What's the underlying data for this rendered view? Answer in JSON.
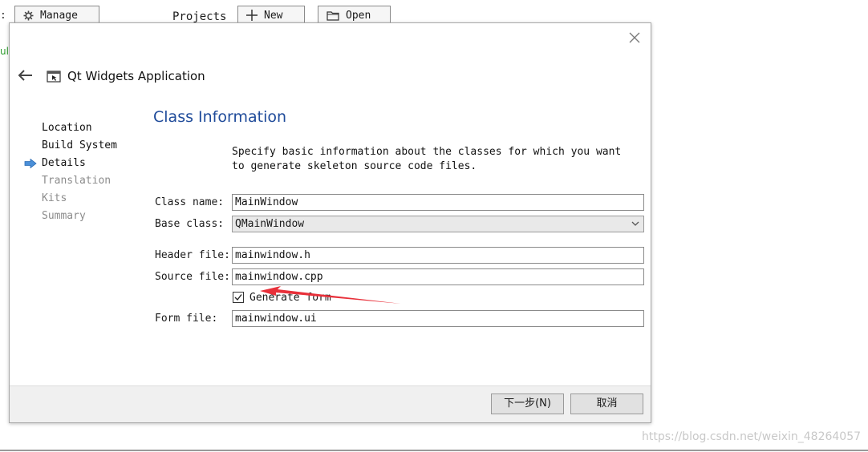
{
  "background": {
    "left_mark": ":",
    "manage_button": "Manage",
    "projects_label": "Projects",
    "new_button": "New",
    "open_button": "Open",
    "green_text": "ul",
    "watermark": "https://blog.csdn.net/weixin_48264057"
  },
  "dialog": {
    "title": "Qt Widgets Application",
    "steps": [
      {
        "label": "Location",
        "state": "done"
      },
      {
        "label": "Build System",
        "state": "done"
      },
      {
        "label": "Details",
        "state": "current"
      },
      {
        "label": "Translation",
        "state": "future"
      },
      {
        "label": "Kits",
        "state": "future"
      },
      {
        "label": "Summary",
        "state": "future"
      }
    ],
    "page_title": "Class Information",
    "description": "Specify basic information about the classes for which you want to generate skeleton source code files.",
    "fields": {
      "class_name_label": "Class name:",
      "class_name_value": "MainWindow",
      "base_class_label": "Base class:",
      "base_class_value": "QMainWindow",
      "header_file_label": "Header file:",
      "header_file_value": "mainwindow.h",
      "source_file_label": "Source file:",
      "source_file_value": "mainwindow.cpp",
      "generate_form_label": "Generate form",
      "generate_form_checked": true,
      "form_file_label": "Form file:",
      "form_file_value": "mainwindow.ui"
    },
    "buttons": {
      "next": "下一步(N)",
      "cancel": "取消"
    }
  },
  "colors": {
    "title_blue": "#1f4b9a",
    "step_arrow": "#4a8fd8",
    "annotation_red": "#e8303a",
    "green": "#2e9c2e"
  }
}
